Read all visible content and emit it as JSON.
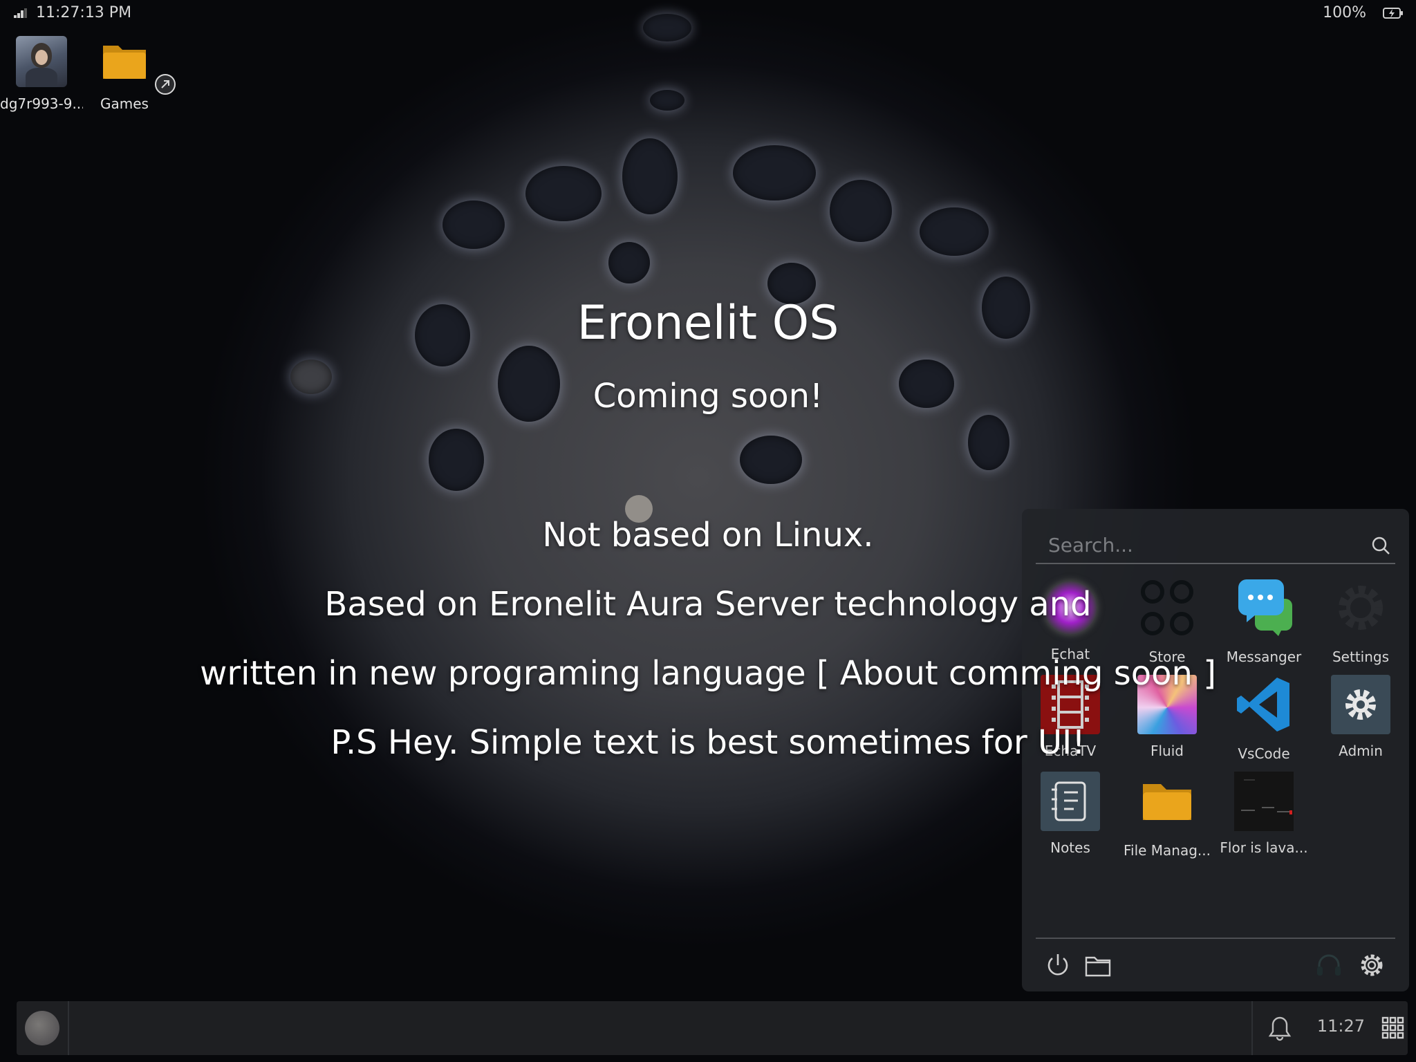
{
  "status_bar": {
    "time": "11:27:13 PM",
    "battery": "100%",
    "signal_icon": "signal-icon",
    "battery_icon": "battery-charging-icon"
  },
  "desktop": {
    "icons": [
      {
        "label": "dg7r993-9...",
        "icon": "image-thumbnail"
      },
      {
        "label": "Games",
        "icon": "folder-shortcut-icon"
      }
    ]
  },
  "main": {
    "title": "Eronelit OS",
    "subtitle": "Coming soon!",
    "lines": [
      "Not based on Linux.",
      "Based on Eronelit Aura Server technology and",
      "written in new programing language [ About comming soon ]",
      "P.S Hey. Simple text is best sometimes for UI!"
    ]
  },
  "start_menu": {
    "search_placeholder": "Search...",
    "apps": [
      {
        "label": "Echat",
        "icon": "echat-icon"
      },
      {
        "label": "Store",
        "icon": "store-icon"
      },
      {
        "label": "Messanger",
        "icon": "messenger-icon"
      },
      {
        "label": "Settings",
        "icon": "settings-gear-icon"
      },
      {
        "label": "EchaTV",
        "icon": "film-icon"
      },
      {
        "label": "Fluid",
        "icon": "fluid-icon"
      },
      {
        "label": "VsCode",
        "icon": "vscode-icon"
      },
      {
        "label": "Admin",
        "icon": "admin-gear-icon"
      },
      {
        "label": "Notes",
        "icon": "notes-icon"
      },
      {
        "label": "File Manag...",
        "icon": "folder-icon"
      },
      {
        "label": "Flor is lava...",
        "icon": "game-thumbnail"
      }
    ],
    "footer": {
      "power_icon": "power-icon",
      "files_icon": "folder-outline-icon",
      "support_icon": "headset-icon",
      "settings_icon": "gear-icon"
    }
  },
  "taskbar": {
    "time": "11:27",
    "bell_icon": "bell-icon",
    "apps_icon": "grid-icon"
  },
  "colors": {
    "folder": "#e8a317",
    "vscode": "#1e8ad6",
    "messenger_bubble": "#3aa8e8",
    "echatv": "#8a1010",
    "panel": "#222428"
  }
}
